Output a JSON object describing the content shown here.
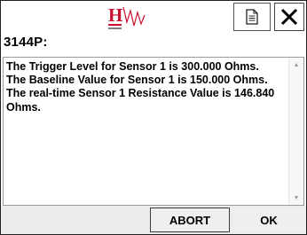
{
  "header": {
    "logo_letter": "H",
    "logo_icon": "signal-waveform-logo",
    "doc_icon": "document-icon",
    "close_glyph": "✕",
    "device_label": "3144P:"
  },
  "message": {
    "lines": [
      "The Trigger Level for Sensor 1 is 300.000 Ohms.",
      "The Baseline Value for Sensor 1 is 150.000 Ohms.",
      "The real-time Sensor 1 Resistance Value is 146.840 Ohms."
    ]
  },
  "scrollbar": {
    "up_glyph": "▲",
    "down_glyph": "▼"
  },
  "buttons": {
    "abort_label": "ABORT",
    "ok_label": "OK"
  },
  "colors": {
    "logo_red": "#c8102e",
    "border": "#222222"
  }
}
